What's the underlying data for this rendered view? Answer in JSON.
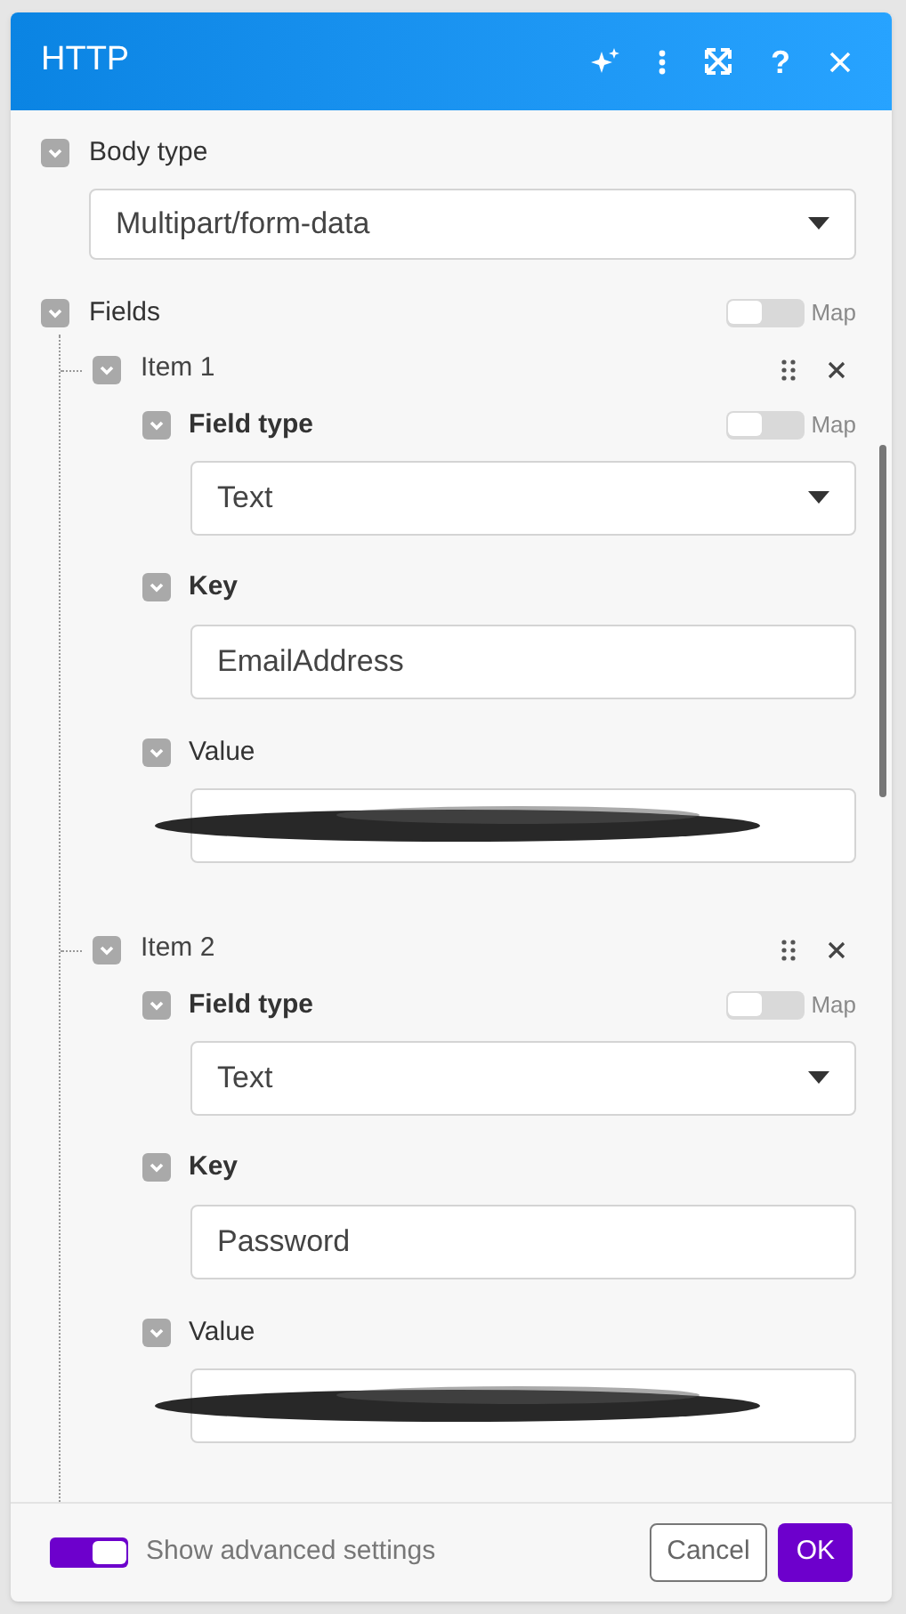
{
  "window": {
    "title": "HTTP",
    "help": "?"
  },
  "body_type": {
    "label": "Body type",
    "expanded": true,
    "value": "Multipart/form-data"
  },
  "fields": {
    "label": "Fields",
    "expanded": true,
    "map": {
      "label": "Map",
      "on": false
    },
    "items": [
      {
        "label": "Item 1",
        "expanded": true,
        "field_type": {
          "label": "Field type",
          "expanded": true,
          "value": "Text",
          "map": {
            "label": "Map",
            "on": false
          }
        },
        "key": {
          "label": "Key",
          "expanded": true,
          "value": "EmailAddress"
        },
        "value": {
          "label": "Value",
          "expanded": true,
          "redacted": true
        }
      },
      {
        "label": "Item 2",
        "expanded": true,
        "field_type": {
          "label": "Field type",
          "expanded": true,
          "value": "Text",
          "map": {
            "label": "Map",
            "on": false
          }
        },
        "key": {
          "label": "Key",
          "expanded": true,
          "value": "Password"
        },
        "value": {
          "label": "Value",
          "expanded": true,
          "redacted": true
        }
      }
    ]
  },
  "footer": {
    "advanced": {
      "label": "Show advanced settings",
      "on": true
    },
    "cancel": "Cancel",
    "ok": "OK"
  }
}
